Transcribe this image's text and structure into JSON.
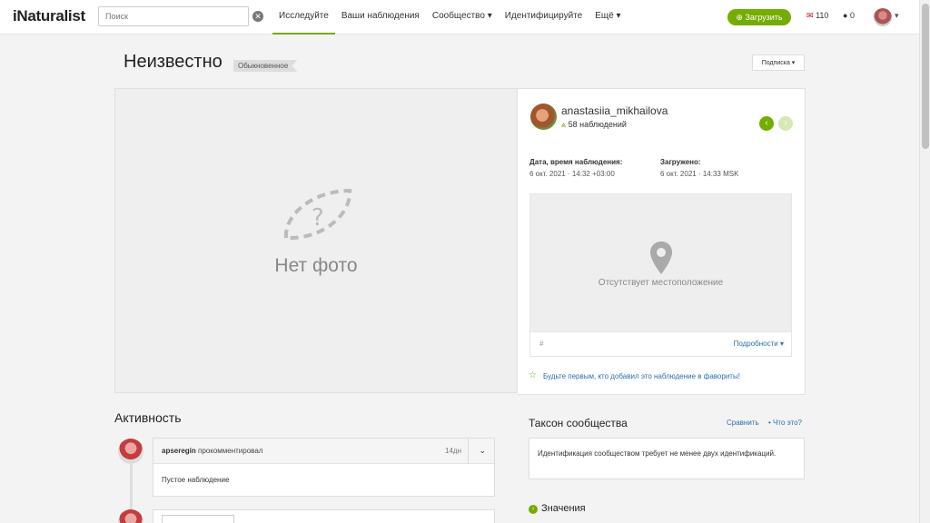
{
  "app": {
    "logo": "iNaturalist"
  },
  "search": {
    "placeholder": "Поиск"
  },
  "nav": {
    "items": [
      {
        "label": "Исследуйте",
        "active": true
      },
      {
        "label": "Ваши наблюдения"
      },
      {
        "label": "Сообщество ▾"
      },
      {
        "label": "Идентифицируйте"
      },
      {
        "label": "Ещё ▾"
      }
    ]
  },
  "header": {
    "upload_label": "Загрузить",
    "messages_count": "110",
    "comments_count": "0"
  },
  "observation": {
    "title": "Неизвестно",
    "rank_badge": "Обыкновенное",
    "subscribe_label": "Подписка ▾",
    "no_photo_text": "Нет фото",
    "user": {
      "username": "anastasiia_mikhailova",
      "observations": "58 наблюдений"
    },
    "observed_label": "Дата, время наблюдения:",
    "observed_value": "6 окт. 2021 · 14:32 +03:00",
    "uploaded_label": "Загружено:",
    "uploaded_value": "6 окт. 2021 · 14:33 MSK",
    "no_location_text": "Отсутствует местоположение",
    "hash_symbol": "#",
    "details_link": "Подробности ▾",
    "favorite_text": "Будьте первым, кто добавил это наблюдение в фавориты!"
  },
  "activity": {
    "title": "Активность",
    "comment": {
      "user": "apseregin",
      "action": "прокомментировал",
      "time": "14дн",
      "body": "Пустое наблюдение"
    }
  },
  "community_taxon": {
    "title": "Таксон сообщества",
    "compare_link": "Сравнить",
    "what_link": "Что это?",
    "body": "Идентификация сообществом требует не менее двух идентификаций."
  },
  "values": {
    "title": "Значения"
  },
  "colors": {
    "brand_green": "#74ac00",
    "link_blue": "#2a6fb0"
  }
}
